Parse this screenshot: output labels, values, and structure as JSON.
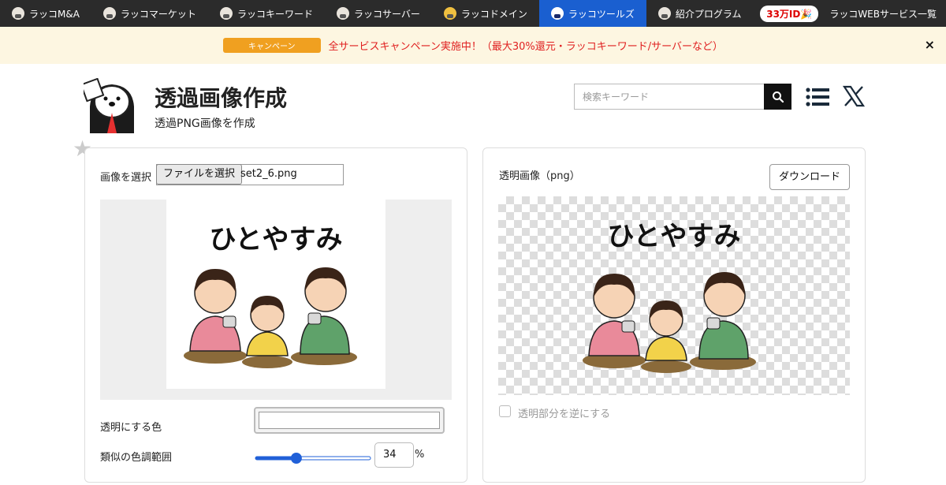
{
  "nav": {
    "items": [
      {
        "label": "ラッコM&A",
        "icon": "rakko-icon"
      },
      {
        "label": "ラッコマーケット",
        "icon": "rakko-icon"
      },
      {
        "label": "ラッコキーワード",
        "icon": "rakko-icon"
      },
      {
        "label": "ラッコサーバー",
        "icon": "rakko-icon"
      },
      {
        "label": "ラッコドメイン",
        "icon": "rakko-icon"
      },
      {
        "label": "ラッコツールズ",
        "icon": "rakko-icon"
      },
      {
        "label": "紹介プログラム",
        "icon": "rakko-icon"
      }
    ],
    "active_index": 5,
    "id_badge": "33万ID🎉",
    "services_link": "ラッコWEBサービス一覧",
    "active_color": "#1a5fd0"
  },
  "banner": {
    "badge": "キャンペーン",
    "text": "全サービスキャンペーン実施中！（最大30%還元・ラッコキーワード/サーバーなど）",
    "close": "×"
  },
  "header": {
    "title": "透過画像作成",
    "subtitle": "透過PNG画像を作成",
    "search_placeholder": "検索キーワード"
  },
  "left_panel": {
    "select_label": "画像を選択",
    "file_button": "ファイルを選択",
    "file_name": "set2_6.png",
    "image_caption": "ひとやすみ",
    "transparent_color_label": "透明にする色",
    "tolerance_label": "類似の色調範囲",
    "tolerance_value": "34",
    "tolerance_unit": "%",
    "tolerance_fraction": 0.34
  },
  "right_panel": {
    "output_label": "透明画像（png）",
    "download_button": "ダウンロード",
    "image_caption": "ひとやすみ",
    "invert_label": "透明部分を逆にする"
  }
}
